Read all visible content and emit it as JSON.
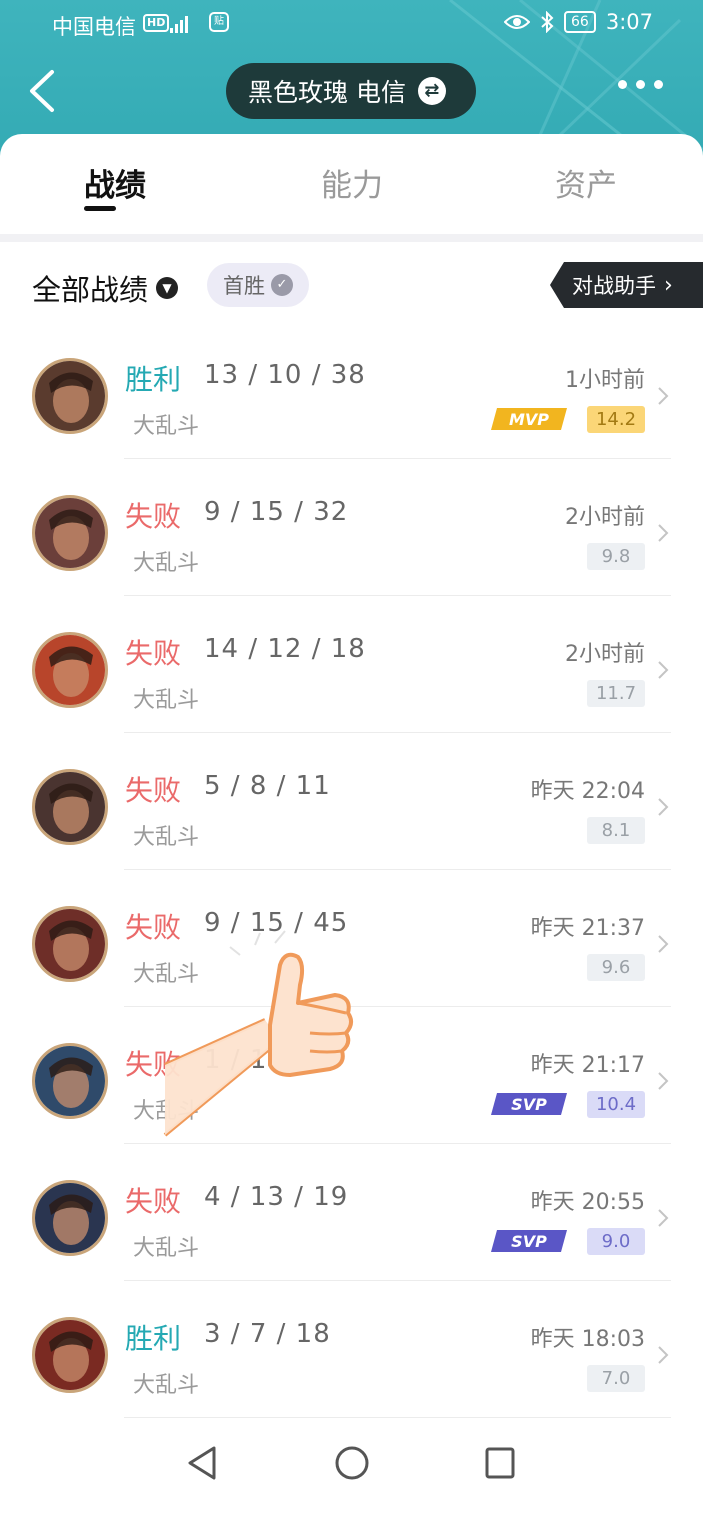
{
  "status_bar": {
    "carrier": "中国电信",
    "hd_badge": "HD",
    "app_badge": "贴",
    "battery": "66",
    "time": "3:07"
  },
  "navbar": {
    "account_name": "黑色玫瑰 电信",
    "swap_icon": "swap-icon"
  },
  "tabs": [
    {
      "label": "战绩",
      "active": true
    },
    {
      "label": "能力",
      "active": false
    },
    {
      "label": "资产",
      "active": false
    }
  ],
  "filters": {
    "all_label": "全部战绩",
    "first_win_label": "首胜",
    "helper_label": "对战助手"
  },
  "matches": [
    {
      "result": "胜利",
      "outcome": "win",
      "kda": "13 / 10 / 38",
      "mode": "大乱斗",
      "time": "1小时前",
      "badge": "MVP",
      "score": "14.2"
    },
    {
      "result": "失败",
      "outcome": "loss",
      "kda": "9 / 15 / 32",
      "mode": "大乱斗",
      "time": "2小时前",
      "badge": "",
      "score": "9.8"
    },
    {
      "result": "失败",
      "outcome": "loss",
      "kda": "14 / 12 / 18",
      "mode": "大乱斗",
      "time": "2小时前",
      "badge": "",
      "score": "11.7"
    },
    {
      "result": "失败",
      "outcome": "loss",
      "kda": "5 / 8 / 11",
      "mode": "大乱斗",
      "time": "昨天 22:04",
      "badge": "",
      "score": "8.1"
    },
    {
      "result": "失败",
      "outcome": "loss",
      "kda": "9 / 15 / 45",
      "mode": "大乱斗",
      "time": "昨天 21:37",
      "badge": "",
      "score": "9.6"
    },
    {
      "result": "失败",
      "outcome": "loss",
      "kda": "1 / 14",
      "mode": "大乱斗",
      "time": "昨天 21:17",
      "badge": "SVP",
      "score": "10.4"
    },
    {
      "result": "失败",
      "outcome": "loss",
      "kda": "4 / 13 / 19",
      "mode": "大乱斗",
      "time": "昨天 20:55",
      "badge": "SVP",
      "score": "9.0"
    },
    {
      "result": "胜利",
      "outcome": "win",
      "kda": "3 / 7 / 18",
      "mode": "大乱斗",
      "time": "昨天 18:03",
      "badge": "",
      "score": "7.0"
    }
  ],
  "colors": {
    "header": "#2ea6b0",
    "win": "#25a9b3",
    "loss": "#ea6a6a",
    "mvp": "#f2b51f",
    "svp": "#5a56c6"
  },
  "avatar_colors": [
    "#5a3b2e",
    "#6b3f3a",
    "#b8452b",
    "#4a3430",
    "#6e2e28",
    "#2f4a6a",
    "#2a3550",
    "#7a2a22"
  ]
}
